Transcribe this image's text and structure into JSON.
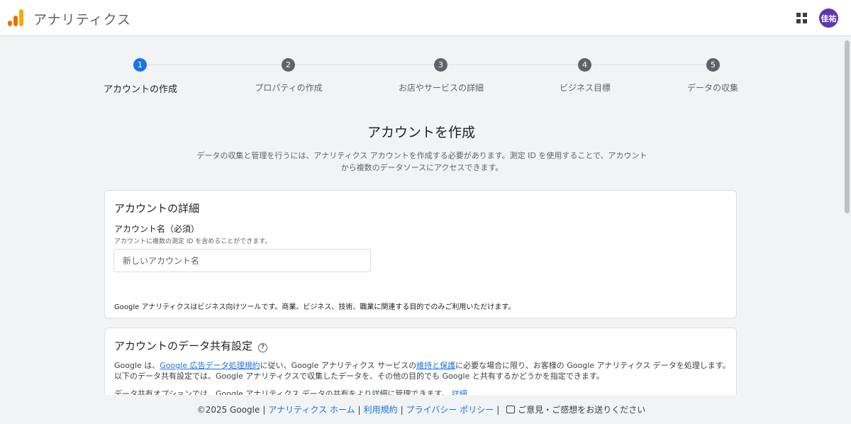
{
  "header": {
    "app_title": "アナリティクス",
    "apps_icon": "apps-grid-icon",
    "avatar_text": "佳祐",
    "avatar_color": "#5e35b1"
  },
  "stepper": {
    "steps": [
      {
        "number": "1",
        "label": "アカウントの作成",
        "active": true
      },
      {
        "number": "2",
        "label": "プロパティの作成",
        "active": false
      },
      {
        "number": "3",
        "label": "お店やサービスの詳細",
        "active": false
      },
      {
        "number": "4",
        "label": "ビジネス目標",
        "active": false
      },
      {
        "number": "5",
        "label": "データの収集",
        "active": false
      }
    ],
    "active_color": "#1a73e8"
  },
  "main": {
    "title": "アカウントを作成",
    "description": "データの収集と管理を行うには、アナリティクス アカウントを作成する必要があります。測定 ID を使用することで、アカウントから複数のデータソースにアクセスできます。"
  },
  "account_details": {
    "title": "アカウントの詳細",
    "field_label": "アカウント名（必須）",
    "field_hint": "アカウントに複数の測定 ID を含めることができます。",
    "field_placeholder": "新しいアカウント名",
    "field_value": "",
    "note": "Google アナリティクスはビジネス向けツールです。商業、ビジネス、技術、職業に関連する目的でのみご利用いただけます。"
  },
  "data_sharing": {
    "title": "アカウントのデータ共有設定",
    "help_icon": "help-circle-icon",
    "text_part1": "Google は、",
    "link1": "Google 広告データ処理規約",
    "text_part2": "に従い、Google アナリティクス サービスの",
    "link2": "維持と保護",
    "text_part3": "に必要な場合に限り、お客様の Google アナリティクス データを処理します。以下のデータ共有設定では、Google アナリティクスで収集したデータを、その他の目的でも Google と共有するかどうかを指定できます。",
    "options_text": "データ共有オプションでは、Google アナリティクス データの共有をより詳細に管理できます。",
    "options_link": "詳細"
  },
  "footer": {
    "copyright": "©2025 Google",
    "link_home": "アナリティクス ホーム",
    "link_terms": "利用規約",
    "link_privacy": "プライバシー ポリシー",
    "feedback": "ご意見・ご感想をお送りください"
  }
}
